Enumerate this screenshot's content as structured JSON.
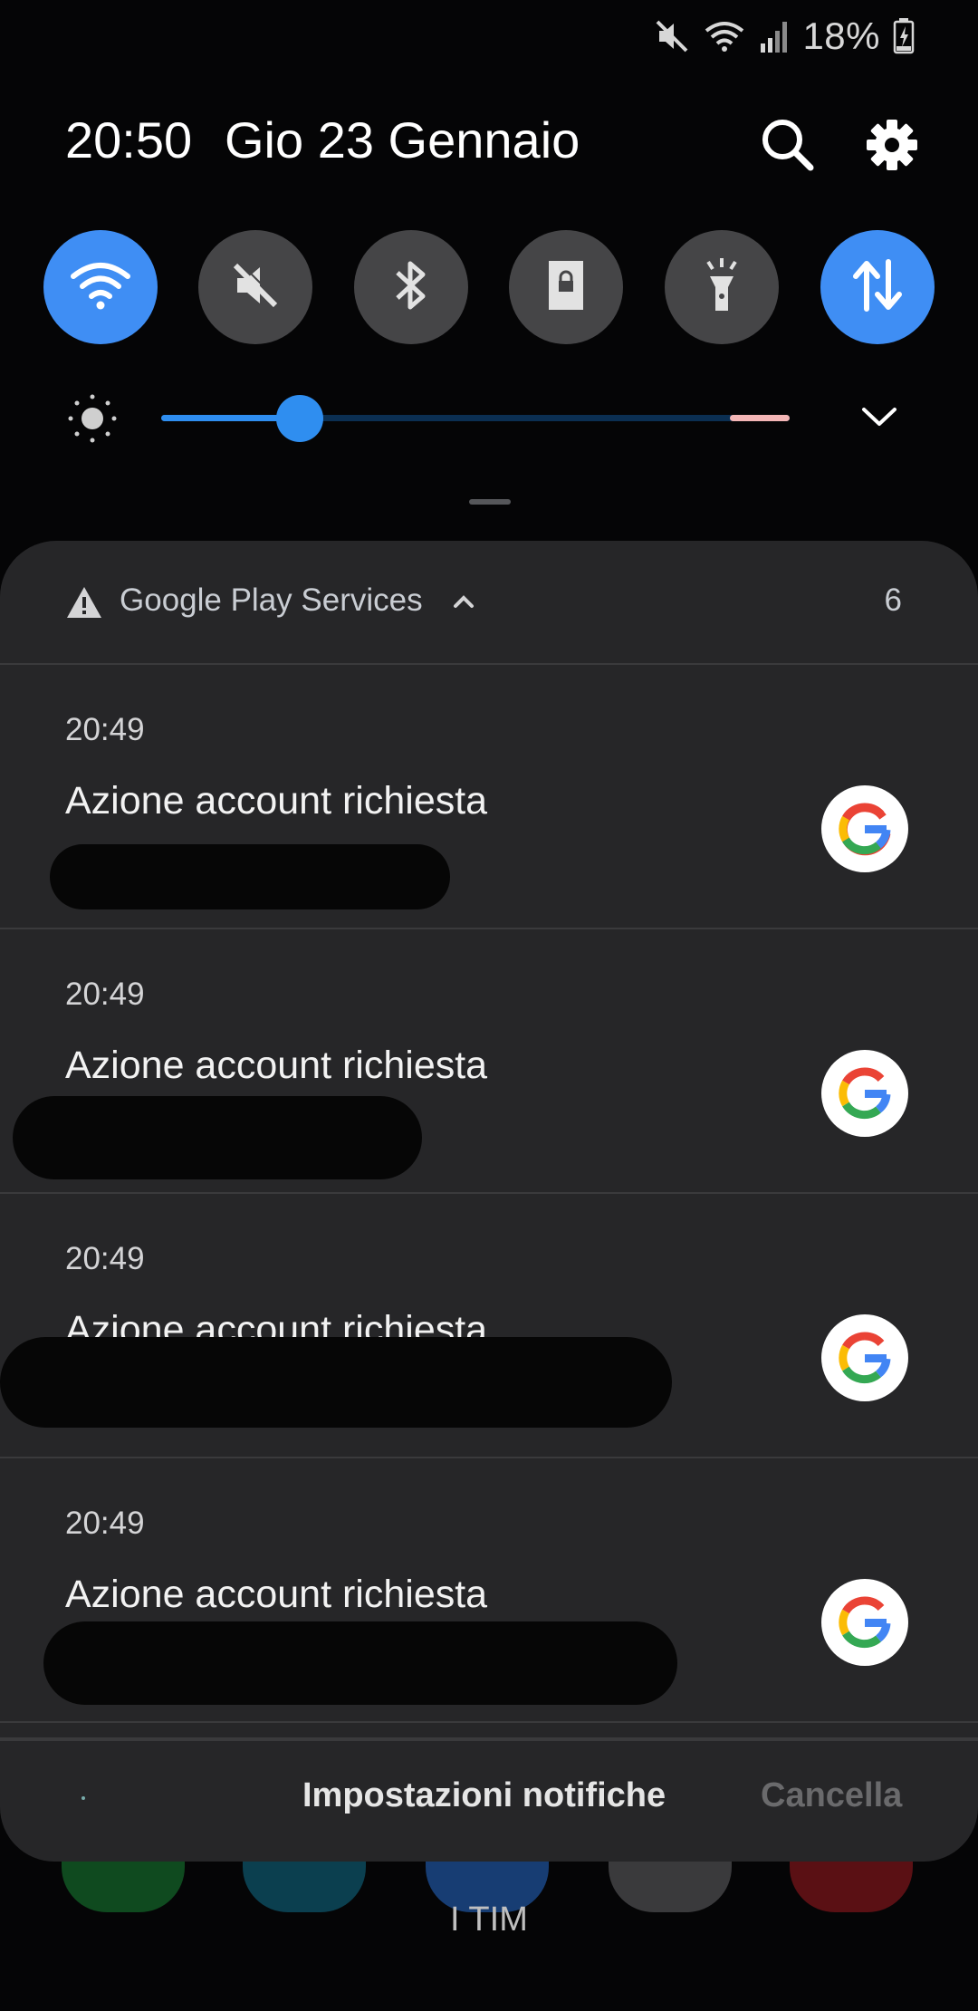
{
  "status_bar": {
    "battery_percent": "18%",
    "icons": [
      "mute-icon",
      "wifi-icon",
      "signal-icon",
      "battery-charging-icon"
    ]
  },
  "header": {
    "time": "20:50",
    "date": "Gio 23 Gennaio",
    "icons": [
      "search-icon",
      "settings-icon"
    ]
  },
  "quick_toggles": [
    {
      "name": "wifi",
      "icon": "wifi-icon",
      "on": true
    },
    {
      "name": "sound",
      "icon": "mute-icon",
      "on": false
    },
    {
      "name": "bluetooth",
      "icon": "bluetooth-icon",
      "on": false
    },
    {
      "name": "rotation-lock",
      "icon": "lock-icon",
      "on": false
    },
    {
      "name": "flashlight",
      "icon": "flashlight-icon",
      "on": false
    },
    {
      "name": "mobile-data",
      "icon": "data-arrows-icon",
      "on": true
    }
  ],
  "brightness": {
    "level": 0.22,
    "icon": "brightness-icon"
  },
  "notification_group": {
    "app": "Google Play Services",
    "count": "6",
    "icon": "warning-icon",
    "items": [
      {
        "time": "20:49",
        "title": "Azione account richiesta",
        "icon": "google-g-icon"
      },
      {
        "time": "20:49",
        "title": "Azione account richiesta",
        "icon": "google-g-icon"
      },
      {
        "time": "20:49",
        "title": "Azione account richiesta",
        "icon": "google-g-icon"
      },
      {
        "time": "20:49",
        "title": "Azione account richiesta",
        "icon": "google-g-icon"
      }
    ]
  },
  "footer": {
    "settings_label": "Impostazioni notifiche",
    "clear_label": "Cancella"
  },
  "home": {
    "carrier": "I TIM"
  },
  "colors": {
    "accent": "#3f8ef4",
    "panel": "#262628",
    "background": "#050506"
  }
}
